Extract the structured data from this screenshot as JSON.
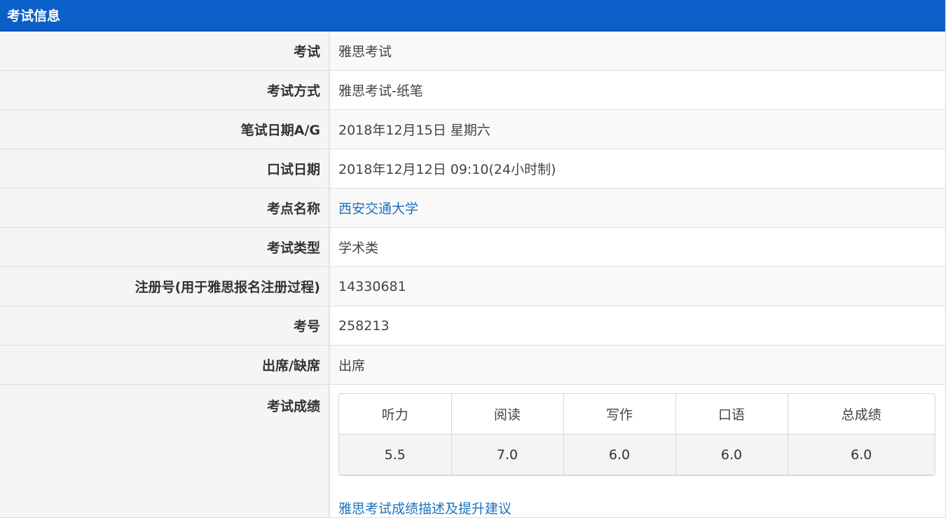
{
  "header": {
    "title": "考试信息"
  },
  "rows": [
    {
      "label": "考试",
      "value": "雅思考试"
    },
    {
      "label": "考试方式",
      "value": "雅思考试-纸笔"
    },
    {
      "label": "笔试日期A/G",
      "value": "2018年12月15日 星期六"
    },
    {
      "label": "口试日期",
      "value": "2018年12月12日 09:10(24小时制)"
    },
    {
      "label": "考点名称",
      "value": "西安交通大学"
    },
    {
      "label": "考试类型",
      "value": "学术类"
    },
    {
      "label": "注册号(用于雅思报名注册过程)",
      "value": "14330681"
    },
    {
      "label": "考号",
      "value": "258213"
    },
    {
      "label": "出席/缺席",
      "value": "出席"
    }
  ],
  "scores": {
    "label": "考试成绩",
    "headers": [
      "听力",
      "阅读",
      "写作",
      "口语",
      "总成绩"
    ],
    "values": [
      "5.5",
      "7.0",
      "6.0",
      "6.0",
      "6.0"
    ],
    "advice_link": "雅思考试成绩描述及提升建议"
  }
}
